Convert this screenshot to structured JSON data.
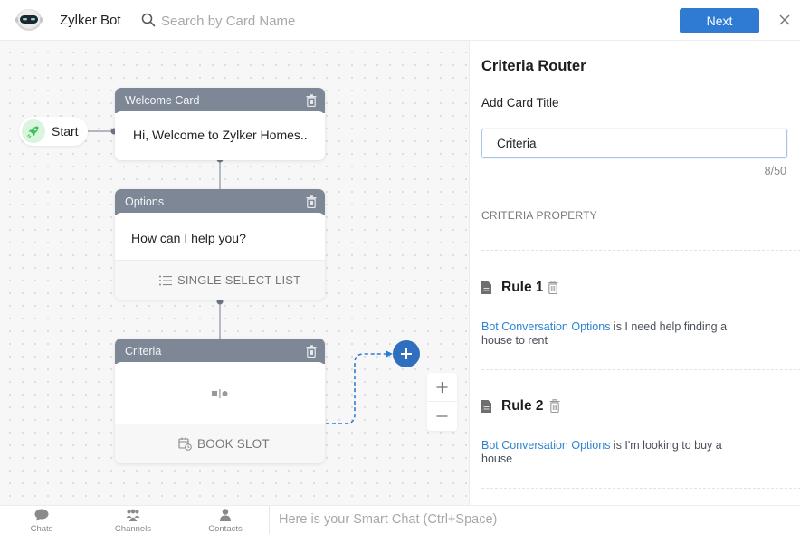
{
  "header": {
    "bot_name": "Zylker Bot",
    "bot_avatar_icon": "robot-icon",
    "search_placeholder": "Search by Card Name",
    "search_value": "",
    "next_label": "Next",
    "close_icon": "close-icon"
  },
  "canvas": {
    "start": {
      "label": "Start",
      "icon": "rocket-icon"
    },
    "cards": [
      {
        "title": "Welcome Card",
        "text": "Hi, Welcome to Zylker Homes..",
        "footer": null
      },
      {
        "title": "Options",
        "text": "How can I help you?",
        "footer": "SINGLE SELECT LIST",
        "footer_icon": "list-icon"
      },
      {
        "title": "Criteria",
        "text": "",
        "body_icon": "criteria-router-icon",
        "footer": "BOOK SLOT",
        "footer_icon": "calendar-clock-icon"
      }
    ],
    "zoom": {
      "in_label": "+",
      "out_label": "−"
    },
    "colors": {
      "accent": "#2f6fbd",
      "card_header": "#7d8795",
      "connector": "#7d8795",
      "dashed_connector": "#2f7bd3"
    }
  },
  "panel": {
    "title": "Criteria Router",
    "card_title_label": "Add Card Title",
    "card_title_value": "Criteria",
    "char_count": "8/50",
    "section_label": "CRITERIA PROPERTY",
    "rules": [
      {
        "name": "Rule 1",
        "property": "Bot Conversation Options",
        "condition": " is I need help finding a house to rent"
      },
      {
        "name": "Rule 2",
        "property": "Bot Conversation Options",
        "condition": " is I'm looking to buy a house"
      }
    ]
  },
  "bottombar": {
    "nav": [
      {
        "label": "Chats",
        "icon": "chat-bubble-icon"
      },
      {
        "label": "Channels",
        "icon": "group-icon"
      },
      {
        "label": "Contacts",
        "icon": "person-icon"
      }
    ],
    "smart_chat_placeholder": "Here is your Smart Chat (Ctrl+Space)"
  }
}
